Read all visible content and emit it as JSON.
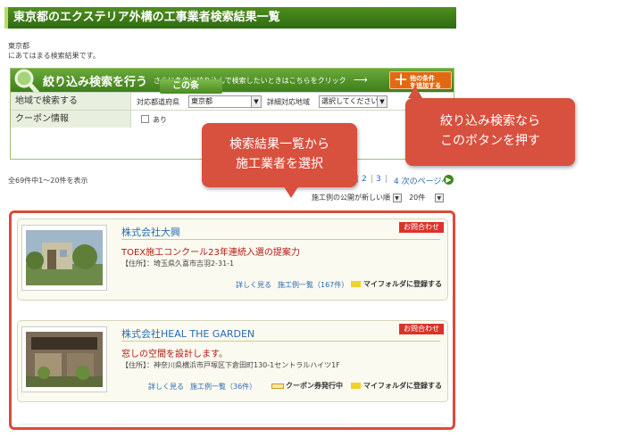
{
  "header": {
    "title": "東京都のエクステリア外構の工事業者検索結果一覧"
  },
  "breadcrumb": {
    "pref": "東京都",
    "intro": "にあてはまる検索結果です。"
  },
  "filter": {
    "title": "絞り込み検索を行う",
    "subtitle": "さらに条件に絞り込んで検索したいときはこちらをクリック",
    "add_button_line1": "他の条件",
    "add_button_line2": "を追加する",
    "region_label": "地域で検索する",
    "pref_label": "対応都道府県",
    "pref_value": "東京都",
    "detail_label": "詳細対応地域",
    "detail_value": "選択してください",
    "coupon_label": "クーポン情報",
    "coupon_option": "あり",
    "search_button": "この条"
  },
  "results_info": {
    "count": "全69件中1〜20件を表示",
    "pages": [
      "1",
      "2",
      "3",
      "4"
    ],
    "next": "次のページへ",
    "sort_value": "施工例の公開が新しい順",
    "per_page": "20件"
  },
  "cards": [
    {
      "name": "株式会社大興",
      "inquiry": "お問合わせ",
      "catch": "TOEX施工コンクール23年連続入選の提案力",
      "address": "【住所】：埼玉県久喜市吉羽2-31-1",
      "link_detail": "詳しく見る",
      "link_works": "施工例一覧（167件）",
      "folder": "マイフォルダに登録する"
    },
    {
      "name": "株式会社HEAL THE GARDEN",
      "inquiry": "お問合わせ",
      "catch": "窓しの空間を設計します。",
      "address": "【住所】：神奈川県横浜市戸塚区下倉田町130-1セントラルハイツ1F",
      "link_detail": "詳しく見る",
      "link_works": "施工例一覧（36件）",
      "coupon": "クーポン券発行中",
      "folder": "マイフォルダに登録する"
    }
  ],
  "callouts": {
    "results_line1": "検索結果一覧から",
    "results_line2": "施工業者を選択",
    "filter_line1": "絞り込み検索なら",
    "filter_line2": "このボタンを押す"
  },
  "colors": {
    "brand_green": "#3f7e1b",
    "accent_orange": "#e06a14",
    "callout_red": "#d8503e",
    "link_blue": "#2a6bb0"
  }
}
